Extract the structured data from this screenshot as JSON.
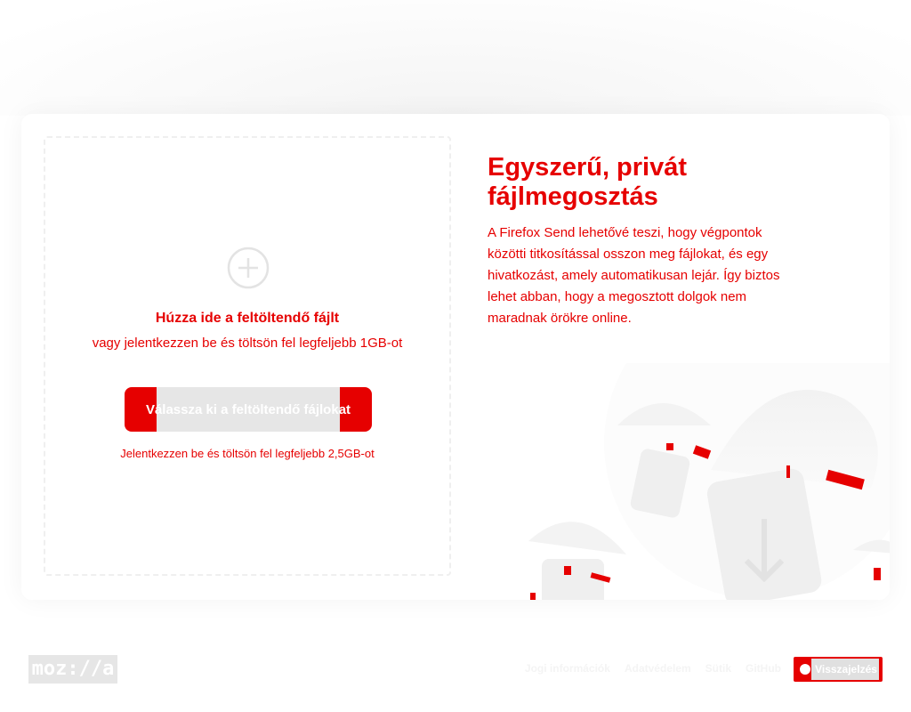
{
  "hero": {
    "title": "Egyszerű, privát fájlmegosztás",
    "text": "A Firefox Send lehetővé teszi, hogy végpontok közötti titkosítással osszon meg fájlokat, és egy hivatkozást, amely automatikusan lejár. Így biztos lehet abban, hogy a megosztott dolgok nem maradnak örökre online."
  },
  "upload": {
    "drop_title": "Húzza ide a feltöltendő fájlt",
    "drop_sub": "vagy jelentkezzen be és töltsön fel legfeljebb 1GB-ot",
    "button_label": "Válassza ki a feltöltendő fájlokat",
    "signin_link": "Jelentkezzen be és töltsön fel legfeljebb 2,5GB-ot"
  },
  "footer": {
    "logo": "moz://a",
    "links": [
      "Jogi információk",
      "Adatvédelem",
      "Sütik",
      "GitHub"
    ],
    "feedback_label": "Visszajelzés"
  },
  "colors": {
    "accent": "#e60000",
    "placeholder_gray": "#e6e6e6"
  },
  "icons": [
    "plus-circle-icon",
    "feedback-icon"
  ]
}
